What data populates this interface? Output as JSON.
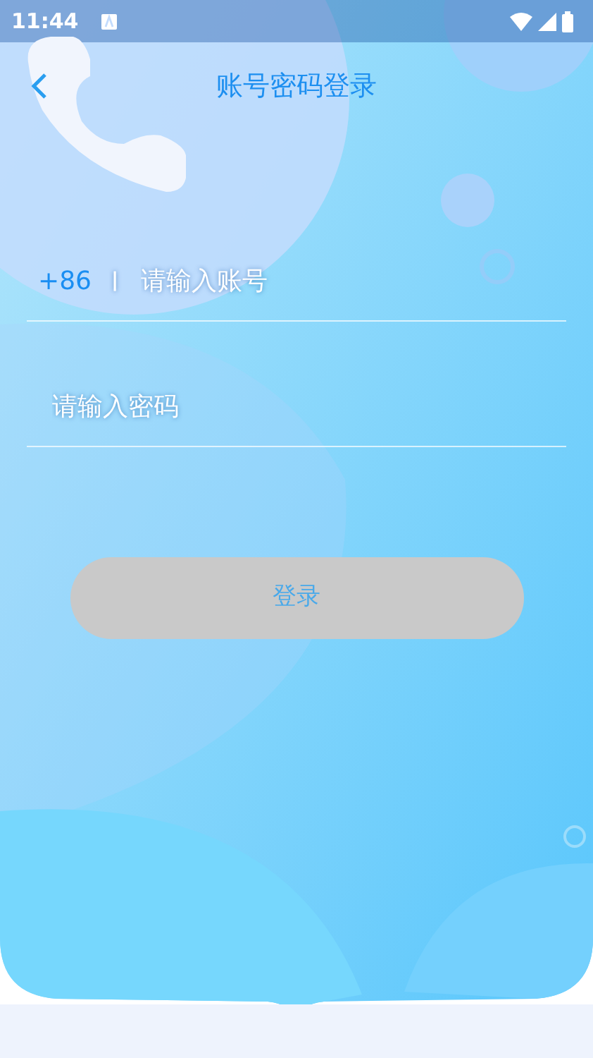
{
  "status_bar": {
    "time": "11:44"
  },
  "header": {
    "title": "账号密码登录"
  },
  "account_field": {
    "country_code": "+86",
    "separator": "|",
    "placeholder": "请输入账号"
  },
  "password_field": {
    "placeholder": "请输入密码"
  },
  "login_button": {
    "label": "登录",
    "disabled": true
  }
}
